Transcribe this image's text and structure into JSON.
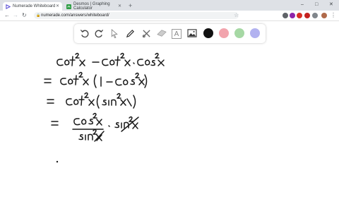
{
  "browser": {
    "tabs": [
      {
        "title": "Numerade Whiteboard",
        "active": true
      },
      {
        "title": "Desmos | Graphing Calculator",
        "active": false
      }
    ],
    "new_tab": "+",
    "url": "numerade.com/answers/whiteboard/",
    "window_controls": [
      "–",
      "□",
      "✕"
    ]
  },
  "whiteboard_toolbar": {
    "tools": [
      "undo-icon",
      "redo-icon",
      "select-icon",
      "pen-icon",
      "tools-icon",
      "eraser-icon",
      "text-icon",
      "image-icon"
    ],
    "text_tool_glyph": "A",
    "colors": [
      "#111111",
      "#f2a4ad",
      "#a6d8a4",
      "#b2b2f0"
    ]
  },
  "handwriting": [
    "cot²x − cot²x · cos²x",
    "= cot²x (1 − cos²x)",
    "= cot²x (sin²x)",
    "= cos²x / sin²x · sin²x"
  ]
}
